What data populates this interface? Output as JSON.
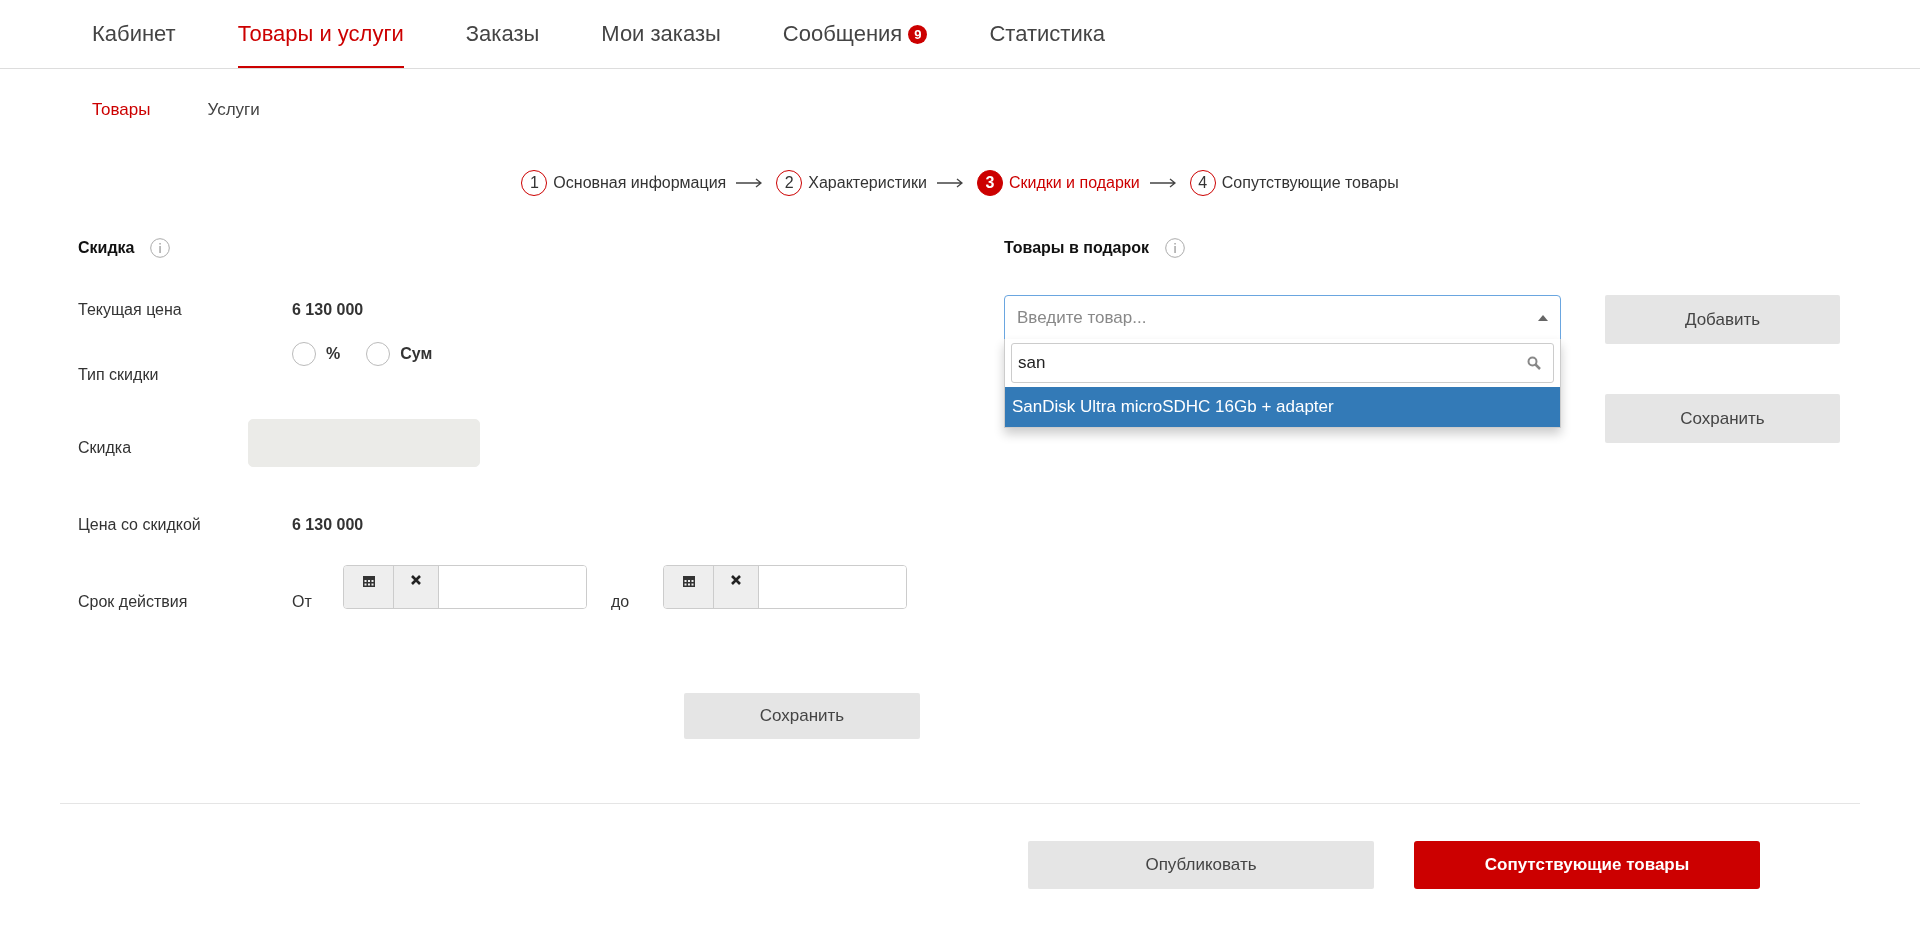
{
  "nav": {
    "tabs": [
      {
        "label": "Кабинет",
        "selected": false
      },
      {
        "label": "Товары и услуги",
        "selected": true
      },
      {
        "label": "Заказы",
        "selected": false
      },
      {
        "label": "Мои заказы",
        "selected": false
      },
      {
        "label": "Сообщения",
        "selected": false,
        "badge": "9"
      },
      {
        "label": "Статистика",
        "selected": false
      }
    ]
  },
  "subtabs": [
    {
      "label": "Товары",
      "selected": true
    },
    {
      "label": "Услуги",
      "selected": false
    }
  ],
  "steps": [
    {
      "number": "1",
      "label": "Основная информация",
      "selected": false
    },
    {
      "number": "2",
      "label": "Характеристики",
      "selected": false
    },
    {
      "number": "3",
      "label": "Скидки и подарки",
      "selected": true
    },
    {
      "number": "4",
      "label": "Сопутствующие товары",
      "selected": false
    }
  ],
  "discount": {
    "title": "Скидка",
    "current_price": {
      "label": "Текущая цена",
      "value": "6 130 000"
    },
    "discount_type": {
      "label": "Тип скидки",
      "options": [
        {
          "label": "%",
          "selected": false
        },
        {
          "label": "Сум",
          "selected": false
        }
      ]
    },
    "discount_field": {
      "label": "Скидка",
      "disabled": true
    },
    "discounted_price": {
      "label": "Цена со скидкой",
      "value": "6 130 000"
    },
    "validity": {
      "label": "Срок действия",
      "from_label": "От",
      "to_label": "до"
    },
    "save_button": "Сохранить"
  },
  "gifts": {
    "title": "Товары в подарок",
    "select": {
      "placeholder": "Введите товар...",
      "expanded": true,
      "search_value": "san",
      "options": [
        {
          "label": "SanDisk Ultra microSDHC 16Gb + adapter",
          "selected": true
        }
      ]
    },
    "add_button": "Добавить",
    "save_button": "Сохранить"
  },
  "footer": {
    "publish_button": "Опубликовать",
    "next_button": "Сопутствующие товары"
  }
}
